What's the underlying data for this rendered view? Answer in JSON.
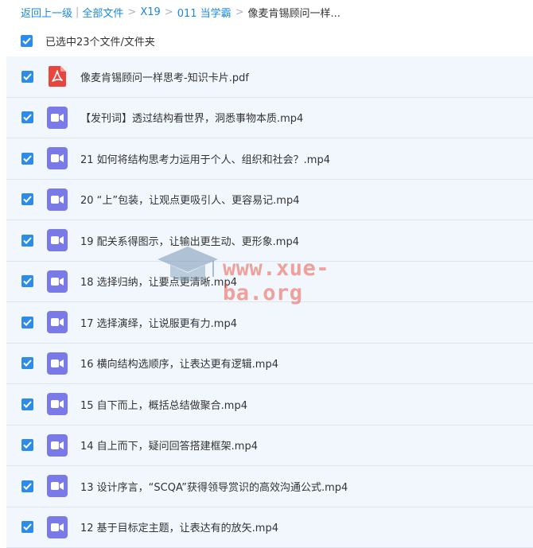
{
  "breadcrumb": {
    "back": "返回上一级",
    "all_files": "全部文件",
    "path": [
      "X19",
      "011 当学霸"
    ],
    "current": "像麦肯锡顾问一样..."
  },
  "selection": {
    "label": "已选中23个文件/文件夹"
  },
  "files": [
    {
      "name": "像麦肯锡顾问一样思考-知识卡片.pdf",
      "type": "pdf"
    },
    {
      "name": "【发刊词】透过结构看世界，洞悉事物本质.mp4",
      "type": "video"
    },
    {
      "name": "21 如何将结构思考力运用于个人、组织和社会？.mp4",
      "type": "video"
    },
    {
      "name": "20 “上”包装，让观点更吸引人、更容易记.mp4",
      "type": "video"
    },
    {
      "name": "19 配关系得图示，让输出更生动、更形象.mp4",
      "type": "video"
    },
    {
      "name": "18 选择归纳，让要点更清晰.mp4",
      "type": "video"
    },
    {
      "name": "17 选择演绎，让说服更有力.mp4",
      "type": "video"
    },
    {
      "name": "16 横向结构选顺序，让表达更有逻辑.mp4",
      "type": "video"
    },
    {
      "name": "15 自下而上，概括总结做聚合.mp4",
      "type": "video"
    },
    {
      "name": "14 自上而下，疑问回答搭建框架.mp4",
      "type": "video"
    },
    {
      "name": "13 设计序言，“SCQA”获得领导赏识的高效沟通公式.mp4",
      "type": "video"
    },
    {
      "name": "12 基于目标定主题，让表达有的放矢.mp4",
      "type": "video"
    }
  ],
  "watermark": {
    "text": "www.xue-ba.org"
  },
  "colors": {
    "accent": "#2c8ce8",
    "link": "#1a87e0",
    "video_icon": "#7a79e8",
    "pdf_icon": "#e8453c",
    "row_bg": "#f2f7fd"
  }
}
